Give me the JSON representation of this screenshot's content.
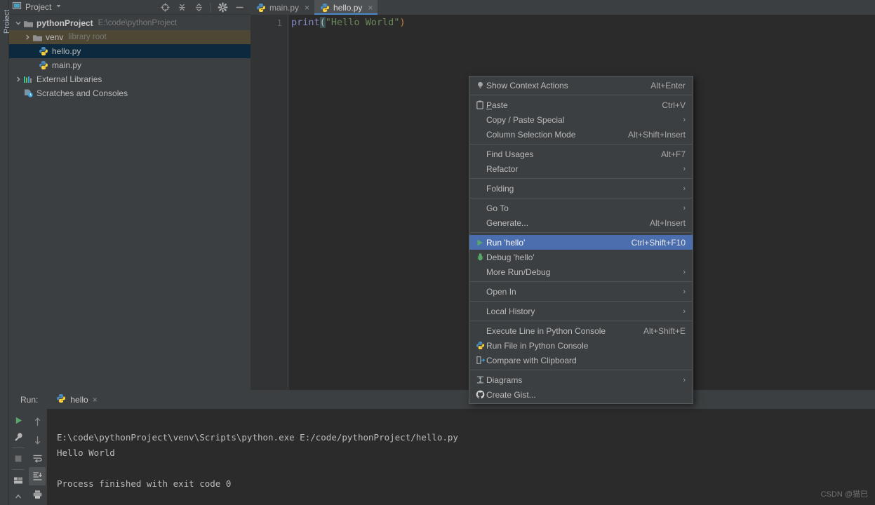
{
  "app": {
    "left_strip_label": "Project"
  },
  "project_panel": {
    "title": "Project",
    "title_icon": "project-window-icon",
    "toolbar": [
      {
        "name": "locate-target-icon",
        "tooltip": "Select Opened File"
      },
      {
        "name": "expand-all-icon",
        "tooltip": "Expand All"
      },
      {
        "name": "collapse-all-icon",
        "tooltip": "Collapse All"
      },
      {
        "name": "settings-gear-icon",
        "tooltip": "Options"
      },
      {
        "name": "hide-minimize-icon",
        "tooltip": "Hide"
      }
    ],
    "tree": [
      {
        "label": "pythonProject",
        "detail": "E:\\code\\pythonProject",
        "icon": "folder-icon",
        "indent": 0,
        "expanded": true,
        "bold": true,
        "state": "none"
      },
      {
        "label": "venv",
        "detail": "library root",
        "icon": "folder-icon",
        "indent": 1,
        "expanded": false,
        "bold": false,
        "state": "venv-highlight"
      },
      {
        "label": "hello.py",
        "detail": "",
        "icon": "python-file-icon",
        "indent": 2,
        "expanded": null,
        "bold": false,
        "state": "selected"
      },
      {
        "label": "main.py",
        "detail": "",
        "icon": "python-file-icon",
        "indent": 2,
        "expanded": null,
        "bold": false,
        "state": "none"
      },
      {
        "label": "External Libraries",
        "detail": "",
        "icon": "external-libraries-icon",
        "indent": 0,
        "expanded": false,
        "bold": false,
        "state": "none"
      },
      {
        "label": "Scratches and Consoles",
        "detail": "",
        "icon": "scratches-icon",
        "indent": 1,
        "expanded": null,
        "bold": false,
        "state": "none"
      }
    ]
  },
  "editor": {
    "tabs": [
      {
        "label": "main.py",
        "icon": "python-file-icon",
        "active": false,
        "close": "×"
      },
      {
        "label": "hello.py",
        "icon": "python-file-icon",
        "active": true,
        "close": "×"
      }
    ],
    "line_numbers": [
      "1"
    ],
    "code_tokens": {
      "function": "print",
      "open_paren": "(",
      "string": "\"Hello World\"",
      "close_paren": ")"
    }
  },
  "context_menu": {
    "items": [
      {
        "label": "Show Context Actions",
        "shortcut": "Alt+Enter",
        "icon": "lightbulb-icon",
        "submenu": false,
        "selected": false,
        "mnemonic": ""
      },
      {
        "type": "separator"
      },
      {
        "label": "Paste",
        "shortcut": "Ctrl+V",
        "icon": "clipboard-icon",
        "submenu": false,
        "selected": false,
        "mnemonic": "P"
      },
      {
        "label": "Copy / Paste Special",
        "shortcut": "",
        "icon": "",
        "submenu": true,
        "selected": false,
        "mnemonic": ""
      },
      {
        "label": "Column Selection Mode",
        "shortcut": "Alt+Shift+Insert",
        "icon": "",
        "submenu": false,
        "selected": false,
        "mnemonic": "M"
      },
      {
        "type": "separator"
      },
      {
        "label": "Find Usages",
        "shortcut": "Alt+F7",
        "icon": "",
        "submenu": false,
        "selected": false,
        "mnemonic": "U"
      },
      {
        "label": "Refactor",
        "shortcut": "",
        "icon": "",
        "submenu": true,
        "selected": false,
        "mnemonic": "R"
      },
      {
        "type": "separator"
      },
      {
        "label": "Folding",
        "shortcut": "",
        "icon": "",
        "submenu": true,
        "selected": false,
        "mnemonic": ""
      },
      {
        "type": "separator"
      },
      {
        "label": "Go To",
        "shortcut": "",
        "icon": "",
        "submenu": true,
        "selected": false,
        "mnemonic": ""
      },
      {
        "label": "Generate...",
        "shortcut": "Alt+Insert",
        "icon": "",
        "submenu": false,
        "selected": false,
        "mnemonic": ""
      },
      {
        "type": "separator"
      },
      {
        "label": "Run 'hello'",
        "shortcut": "Ctrl+Shift+F10",
        "icon": "run-green-play-icon",
        "submenu": false,
        "selected": true,
        "mnemonic": "u"
      },
      {
        "label": "Debug 'hello'",
        "shortcut": "",
        "icon": "debug-bug-icon",
        "submenu": false,
        "selected": false,
        "mnemonic": "D"
      },
      {
        "label": "More Run/Debug",
        "shortcut": "",
        "icon": "",
        "submenu": true,
        "selected": false,
        "mnemonic": ""
      },
      {
        "type": "separator"
      },
      {
        "label": "Open In",
        "shortcut": "",
        "icon": "",
        "submenu": true,
        "selected": false,
        "mnemonic": ""
      },
      {
        "type": "separator"
      },
      {
        "label": "Local History",
        "shortcut": "",
        "icon": "",
        "submenu": true,
        "selected": false,
        "mnemonic": "H"
      },
      {
        "type": "separator"
      },
      {
        "label": "Execute Line in Python Console",
        "shortcut": "Alt+Shift+E",
        "icon": "",
        "submenu": false,
        "selected": false,
        "mnemonic": ""
      },
      {
        "label": "Run File in Python Console",
        "shortcut": "",
        "icon": "python-logo-icon",
        "submenu": false,
        "selected": false,
        "mnemonic": ""
      },
      {
        "label": "Compare with Clipboard",
        "shortcut": "",
        "icon": "compare-clipboard-icon",
        "submenu": false,
        "selected": false,
        "mnemonic": "b"
      },
      {
        "type": "separator"
      },
      {
        "label": "Diagrams",
        "shortcut": "",
        "icon": "diagrams-icon",
        "submenu": true,
        "selected": false,
        "mnemonic": ""
      },
      {
        "label": "Create Gist...",
        "shortcut": "",
        "icon": "github-icon",
        "submenu": false,
        "selected": false,
        "mnemonic": ""
      }
    ],
    "submenu_arrow": "›"
  },
  "run_panel": {
    "label": "Run:",
    "tab_label": "hello",
    "tab_icon": "python-logo-icon",
    "tab_close": "×",
    "toolbar_left": [
      {
        "name": "rerun-play-icon",
        "active": false
      },
      {
        "name": "settings-wrench-icon",
        "active": false
      },
      {
        "name": "stop-square-icon",
        "active": false
      },
      {
        "name": "layout-grid-icon",
        "active": false
      }
    ],
    "toolbar_right": [
      {
        "name": "scroll-up-icon",
        "active": false
      },
      {
        "name": "scroll-down-icon",
        "active": false
      },
      {
        "name": "soft-wrap-icon",
        "active": false
      },
      {
        "name": "scroll-to-end-icon",
        "active": true
      },
      {
        "name": "print-icon",
        "active": false
      }
    ],
    "console_lines": [
      "E:\\code\\pythonProject\\venv\\Scripts\\python.exe E:/code/pythonProject/hello.py",
      "Hello World",
      "",
      "Process finished with exit code 0"
    ]
  },
  "watermark": "CSDN @猫巳",
  "colors": {
    "panel_bg": "#3c3f41",
    "editor_bg": "#2b2b2b",
    "gutter_bg": "#313335",
    "selection_blue": "#0d293e",
    "venv_highlight": "#4e4733",
    "menu_selected": "#4b6eaf",
    "accent_tab_underline": "#4a88c7",
    "text_primary": "#bbbbbb",
    "text_dim": "#787878",
    "string_green": "#6a8759",
    "function_purple": "#8888c6"
  }
}
